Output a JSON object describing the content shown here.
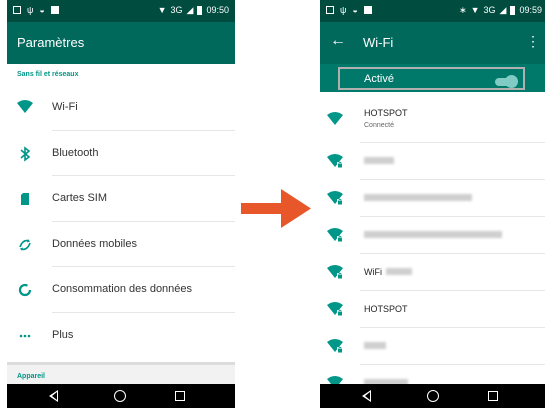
{
  "left_phone": {
    "status_bar": {
      "network": "3G",
      "time": "09:50"
    },
    "app_bar": {
      "title": "Paramètres"
    },
    "section_header": "Sans fil et réseaux",
    "items": [
      {
        "label": "Wi-Fi",
        "icon": "wifi-icon"
      },
      {
        "label": "Bluetooth",
        "icon": "bluetooth-icon"
      },
      {
        "label": "Cartes SIM",
        "icon": "sim-card-icon"
      },
      {
        "label": "Données mobiles",
        "icon": "mobile-data-icon"
      },
      {
        "label": "Consommation des données",
        "icon": "data-usage-icon"
      },
      {
        "label": "Plus",
        "icon": "more-dots-icon"
      }
    ],
    "footer_header": "Appareil"
  },
  "right_phone": {
    "status_bar": {
      "network": "3G",
      "time": "09:59"
    },
    "app_bar": {
      "title": "Wi-Fi"
    },
    "toggle": {
      "label": "Activé",
      "state": "on"
    },
    "networks": [
      {
        "name": "HOTSPOT",
        "status": "Connecté",
        "blurred": false,
        "secured": false
      },
      {
        "name": "",
        "blurred": true,
        "blur_width": 30,
        "secured": true
      },
      {
        "name": "",
        "blurred": true,
        "blur_width": 108,
        "secured": true
      },
      {
        "name": "",
        "blurred": true,
        "blur_width": 138,
        "secured": true
      },
      {
        "name": "WiFi",
        "blurred": true,
        "blur_width": 26,
        "secured": true
      },
      {
        "name": "HOTSPOT",
        "blurred": false,
        "secured": true
      },
      {
        "name": "",
        "blurred": true,
        "blur_width": 22,
        "secured": true
      },
      {
        "name": "",
        "blurred": true,
        "blur_width": 44,
        "secured": true
      }
    ]
  },
  "colors": {
    "status_bar": "#004d40",
    "app_bar": "#00695c",
    "accent": "#009688",
    "arrow": "#e8572a"
  }
}
